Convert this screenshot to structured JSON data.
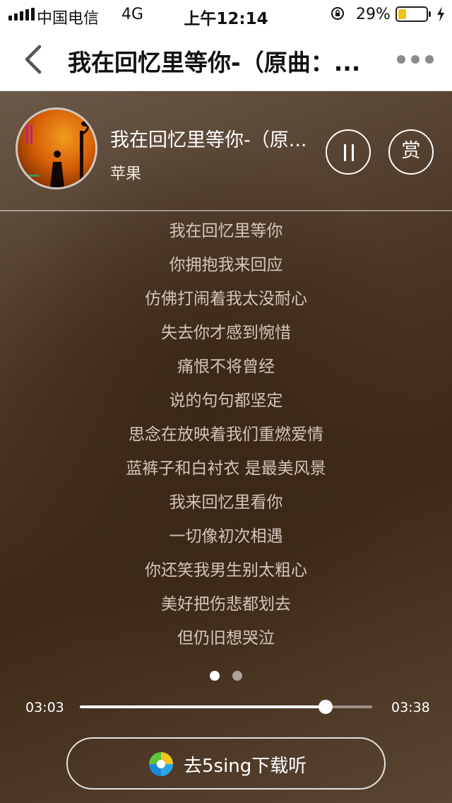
{
  "status_bar": {
    "carrier": "中国电信",
    "network": "4G",
    "time": "上午12:14",
    "battery_percent": "29%",
    "battery_level": 0.29,
    "battery_color": "#f0c419"
  },
  "nav": {
    "back_icon": "chevron-left-icon",
    "title": "我在回忆里等你-（原曲：...",
    "more_icon": "more-dots-icon"
  },
  "player": {
    "song_title": "我在回忆里等你-（原...",
    "artist": "苹果",
    "pause_icon": "pause-icon",
    "reward_label": "赏"
  },
  "lyrics": [
    "我在回忆里等你",
    "你拥抱我来回应",
    "仿佛打闹着我太没耐心",
    "失去你才感到惋惜",
    "痛恨不将曾经",
    "说的句句都坚定",
    "思念在放映着我们重燃爱情",
    "蓝裤子和白衬衣 是最美风景",
    "我来回忆里看你",
    "一切像初次相遇",
    "你还笑我男生别太粗心",
    "美好把伤悲都划去",
    "但仍旧想哭泣"
  ],
  "pager": {
    "pages": 2,
    "active_index": 0
  },
  "progress": {
    "current_time": "03:03",
    "total_time": "03:38",
    "fraction": 0.84
  },
  "download": {
    "label": "去5sing下载听",
    "icon": "5sing-logo-icon"
  }
}
